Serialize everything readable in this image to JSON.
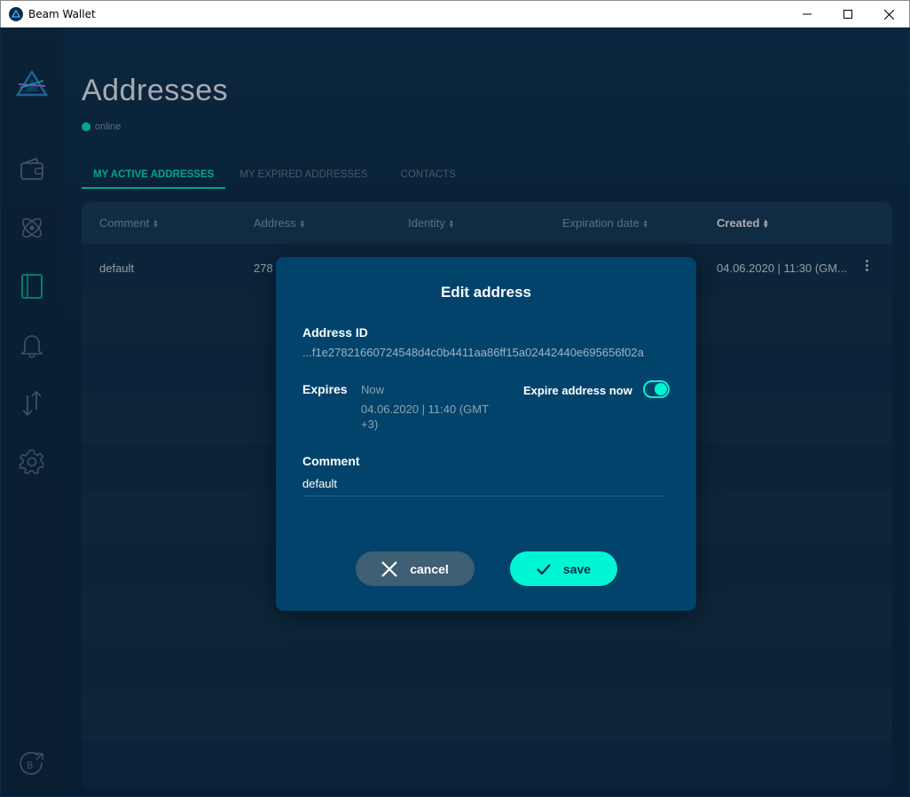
{
  "window": {
    "title": "Beam Wallet"
  },
  "header": {
    "title": "Addresses",
    "status": "online"
  },
  "tabs": [
    {
      "label": "MY ACTIVE ADDRESSES"
    },
    {
      "label": "MY EXPIRED ADDRESSES"
    },
    {
      "label": "CONTACTS"
    }
  ],
  "table": {
    "columns": [
      {
        "label": "Comment"
      },
      {
        "label": "Address"
      },
      {
        "label": "Identity"
      },
      {
        "label": "Expiration date"
      },
      {
        "label": "Created"
      }
    ],
    "rows": [
      {
        "comment": "default",
        "address": "278",
        "created": "04.06.2020 | 11:30 (GM..."
      }
    ]
  },
  "modal": {
    "title": "Edit address",
    "address_id_label": "Address ID",
    "address_id": "...f1e27821660724548d4c0b4411aa86ff15a02442440e695656f02a",
    "expires_label": "Expires",
    "expires_now": "Now",
    "expires_date": "04.06.2020 | 11:40 (GMT +3)",
    "expire_toggle_label": "Expire address now",
    "expire_toggle_on": true,
    "comment_label": "Comment",
    "comment_value": "default",
    "cancel_label": "cancel",
    "save_label": "save"
  },
  "colors": {
    "accent": "#00f6d2",
    "modal_bg": "#02436c",
    "cancel_bg": "#3e5f74"
  },
  "icons": {
    "sidebar": [
      "wallet-icon",
      "atom-icon",
      "address-book-icon",
      "bell-icon",
      "transfer-icon",
      "gear-icon",
      "beam-external-icon"
    ]
  }
}
